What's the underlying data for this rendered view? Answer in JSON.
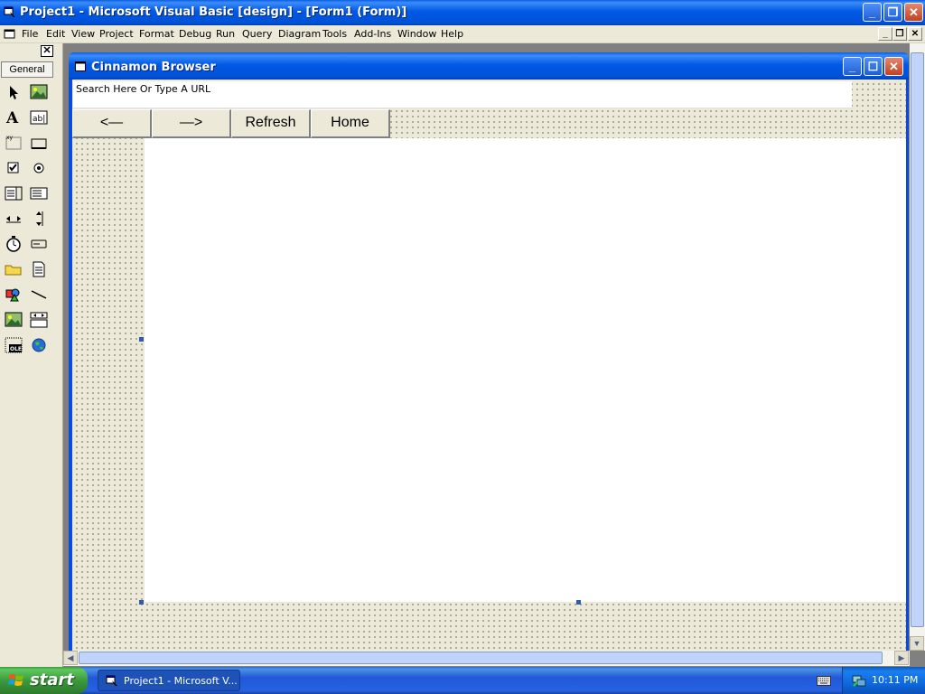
{
  "app": {
    "title": "Project1 - Microsoft Visual Basic [design] - [Form1 (Form)]"
  },
  "menu": {
    "items": [
      "File",
      "Edit",
      "View",
      "Project",
      "Format",
      "Debug",
      "Run",
      "Query",
      "Diagram",
      "Tools",
      "Add-Ins",
      "Window",
      "Help"
    ]
  },
  "toolbox": {
    "tab_label": "General",
    "close_label": "✕",
    "tools": [
      "pointer-icon",
      "picturebox-icon",
      "label-icon",
      "textbox-icon",
      "frame-icon",
      "commandbutton-icon",
      "checkbox-icon",
      "optionbutton-icon",
      "combobox-icon",
      "listbox-icon",
      "hscrollbar-icon",
      "vscrollbar-icon",
      "timer-icon",
      "drivelistbox-icon",
      "dirlistbox-icon",
      "filelistbox-icon",
      "shape-icon",
      "line-icon",
      "image-icon",
      "data-icon",
      "ole-icon",
      "webbrowser-icon"
    ]
  },
  "form": {
    "title": "Cinnamon Browser",
    "url_text": "Search Here Or Type A URL",
    "buttons": {
      "back": "<—",
      "forward": "—>",
      "refresh": "Refresh",
      "home": "Home"
    }
  },
  "taskbar": {
    "start_label": "start",
    "task_label": "Project1 - Microsoft V...",
    "clock": "10:11 PM"
  },
  "colors": {
    "xp_blue": "#0058e6",
    "close_red": "#c5401f",
    "start_green": "#3c9a3c",
    "face": "#ece9d8"
  }
}
